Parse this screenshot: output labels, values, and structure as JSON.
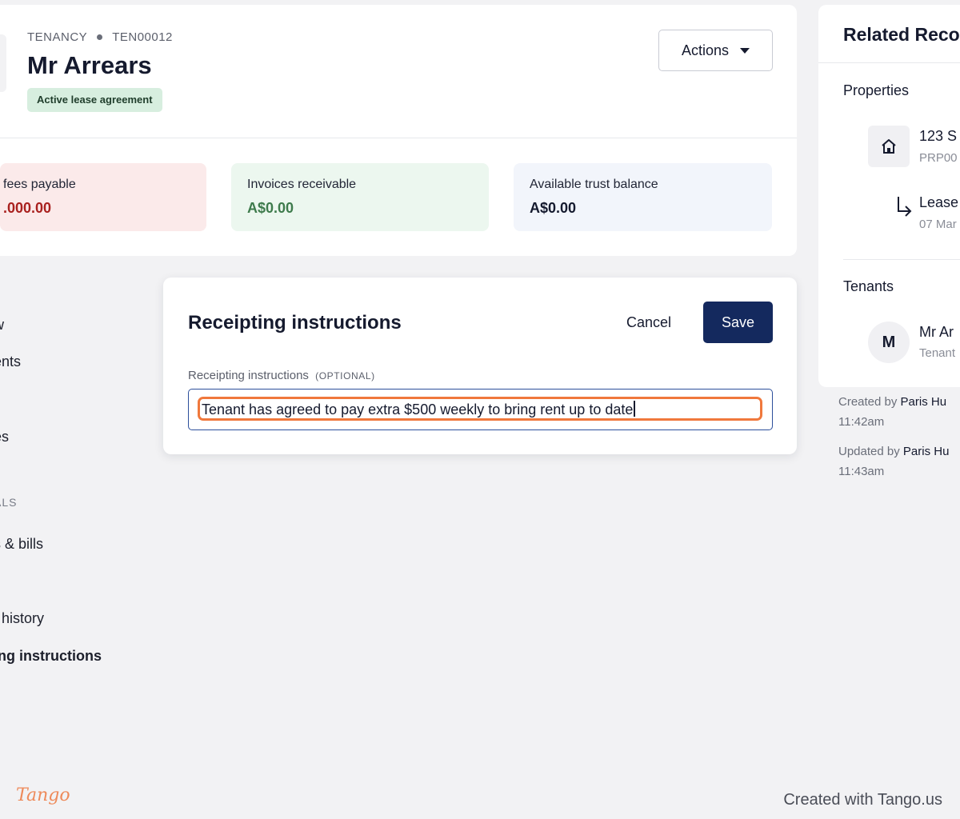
{
  "header": {
    "breadcrumb_type": "TENANCY",
    "breadcrumb_id": "TEN00012",
    "title": "Mr Arrears",
    "status_badge": "Active lease agreement",
    "actions_label": "Actions"
  },
  "stats": [
    {
      "label": "fees payable",
      "value": ".000.00",
      "color": "#a9211f"
    },
    {
      "label": "Invoices receivable",
      "value": "A$0.00",
      "color": "#3e7b4c"
    },
    {
      "label": "Available trust balance",
      "value": "A$0.00",
      "color": "#151a2e"
    }
  ],
  "leftnav": {
    "sections": [
      "L",
      "ALS"
    ],
    "items": [
      "w",
      "ents",
      "es",
      "s & bills",
      "t history",
      "ing instructions"
    ],
    "active_item": "ing instructions"
  },
  "modal": {
    "title": "Receipting instructions",
    "cancel_label": "Cancel",
    "save_label": "Save",
    "field_label": "Receipting instructions",
    "field_optional": "(OPTIONAL)",
    "field_value": "Tenant has agreed to pay extra $500 weekly to bring rent up to date"
  },
  "related": {
    "title": "Related Reco",
    "properties_heading": "Properties",
    "property_name": "123 S",
    "property_id": "PRP00",
    "lease_name": "Lease",
    "lease_date": "07 Mar",
    "tenants_heading": "Tenants",
    "tenant_initial": "M",
    "tenant_name": "Mr Ar",
    "tenant_role": "Tenant"
  },
  "meta": {
    "created_prefix": "Created by",
    "created_by": "Paris Hu",
    "created_time": "11:42am",
    "updated_prefix": "Updated by",
    "updated_by": "Paris Hu",
    "updated_time": "11:43am"
  },
  "footer": {
    "logo": "Tango",
    "credit": "Created with Tango.us"
  },
  "colors": {
    "primary": "#14295e",
    "highlight": "#f0783c",
    "badge_bg": "#d7eedf"
  }
}
